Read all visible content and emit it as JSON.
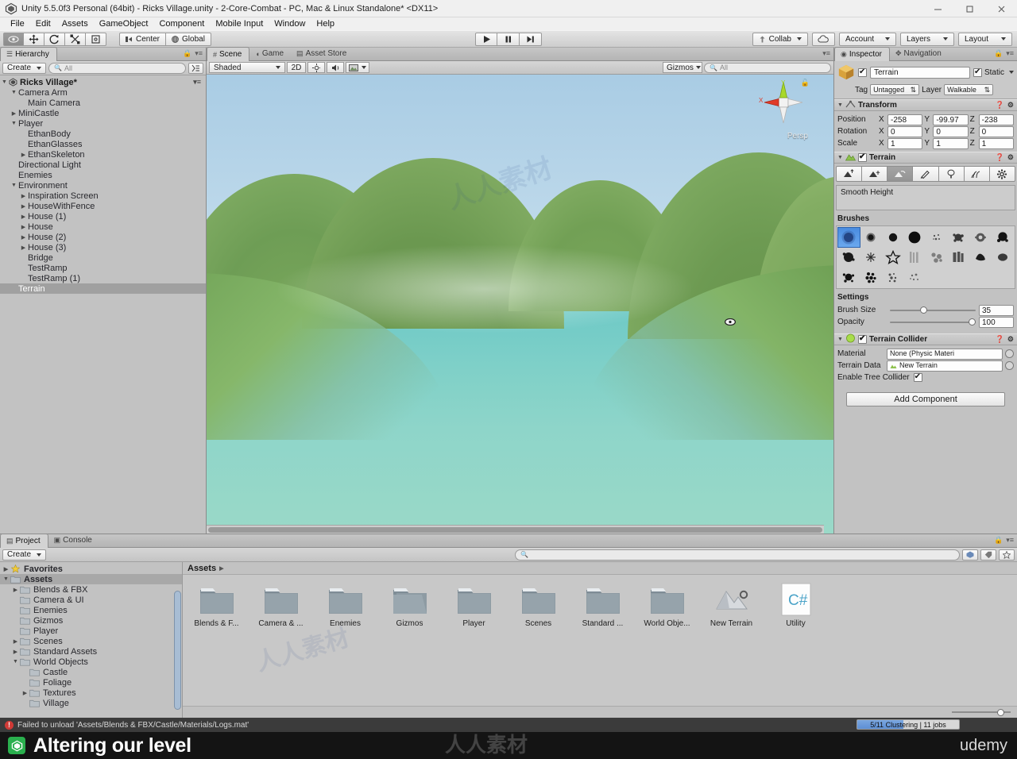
{
  "window": {
    "title": "Unity 5.5.0f3 Personal (64bit) - Ricks Village.unity - 2-Core-Combat - PC, Mac & Linux Standalone* <DX11>",
    "minimize": "–",
    "maximize": "□",
    "close": "✕"
  },
  "menubar": {
    "items": [
      "File",
      "Edit",
      "Assets",
      "GameObject",
      "Component",
      "Mobile Input",
      "Window",
      "Help"
    ]
  },
  "toolbar": {
    "tools": [
      {
        "name": "hand-tool",
        "glyph": "✥",
        "active": true
      },
      {
        "name": "move-tool",
        "glyph": "✛",
        "active": false
      },
      {
        "name": "rotate-tool",
        "glyph": "⟳",
        "active": false
      },
      {
        "name": "scale-tool",
        "glyph": "⤧",
        "active": false
      },
      {
        "name": "rect-tool",
        "glyph": "▣",
        "active": false
      }
    ],
    "pivot_label": "Center",
    "space_label": "Global",
    "play": "▶",
    "pause": "❚❚",
    "step": "▶❙",
    "collab_label": "Collab",
    "account_label": "Account",
    "layers_label": "Layers",
    "layout_label": "Layout"
  },
  "hierarchy": {
    "tab_label": "Hierarchy",
    "create_label": "Create",
    "search_placeholder": "All",
    "root": "Ricks Village*",
    "items": [
      {
        "label": "Camera Arm",
        "indent": 1,
        "arrow": "down"
      },
      {
        "label": "Main Camera",
        "indent": 2,
        "arrow": "none"
      },
      {
        "label": "MiniCastle",
        "indent": 1,
        "arrow": "right"
      },
      {
        "label": "Player",
        "indent": 1,
        "arrow": "down"
      },
      {
        "label": "EthanBody",
        "indent": 2,
        "arrow": "none"
      },
      {
        "label": "EthanGlasses",
        "indent": 2,
        "arrow": "none"
      },
      {
        "label": "EthanSkeleton",
        "indent": 2,
        "arrow": "right"
      },
      {
        "label": "Directional Light",
        "indent": 1,
        "arrow": "none"
      },
      {
        "label": "Enemies",
        "indent": 1,
        "arrow": "none"
      },
      {
        "label": "Environment",
        "indent": 1,
        "arrow": "down"
      },
      {
        "label": "Inspiration Screen",
        "indent": 2,
        "arrow": "right"
      },
      {
        "label": "HouseWithFence",
        "indent": 2,
        "arrow": "right"
      },
      {
        "label": "House (1)",
        "indent": 2,
        "arrow": "right"
      },
      {
        "label": "House",
        "indent": 2,
        "arrow": "right"
      },
      {
        "label": "House (2)",
        "indent": 2,
        "arrow": "right"
      },
      {
        "label": "House (3)",
        "indent": 2,
        "arrow": "right"
      },
      {
        "label": "Bridge",
        "indent": 2,
        "arrow": "none"
      },
      {
        "label": "TestRamp",
        "indent": 2,
        "arrow": "none"
      },
      {
        "label": "TestRamp (1)",
        "indent": 2,
        "arrow": "none"
      },
      {
        "label": "Terrain",
        "indent": 1,
        "arrow": "none",
        "selected": true
      }
    ]
  },
  "scene": {
    "tabs": [
      {
        "label": "Scene",
        "active": true
      },
      {
        "label": "Game",
        "active": false
      },
      {
        "label": "Asset Store",
        "active": false
      }
    ],
    "shading_mode": "Shaded",
    "toggle_2d": "2D",
    "gizmos_label": "Gizmos",
    "gizmos_search_placeholder": "All",
    "axis_x": "X",
    "axis_y": "Y",
    "perspective_label": "Persp"
  },
  "inspector": {
    "tabs": [
      {
        "label": "Inspector",
        "active": true
      },
      {
        "label": "Navigation",
        "active": false
      }
    ],
    "object_name": "Terrain",
    "object_enabled": true,
    "static_label": "Static",
    "static_checked": true,
    "tag_label": "Tag",
    "tag_value": "Untagged",
    "layer_label": "Layer",
    "layer_value": "Walkable",
    "transform": {
      "title": "Transform",
      "rows": [
        {
          "label": "Position",
          "x": "-258",
          "y": "-99.97",
          "z": "-238"
        },
        {
          "label": "Rotation",
          "x": "0",
          "y": "0",
          "z": "0"
        },
        {
          "label": "Scale",
          "x": "1",
          "y": "1",
          "z": "1"
        }
      ],
      "axes": [
        "X",
        "Y",
        "Z"
      ]
    },
    "terrain": {
      "title": "Terrain",
      "enabled": true,
      "tools": [
        {
          "name": "raise-lower-terrain-tool",
          "active": false
        },
        {
          "name": "paint-height-tool",
          "active": false
        },
        {
          "name": "smooth-height-tool",
          "active": true
        },
        {
          "name": "paint-texture-tool",
          "active": false
        },
        {
          "name": "place-trees-tool",
          "active": false
        },
        {
          "name": "paint-details-tool",
          "active": false
        },
        {
          "name": "terrain-settings-tool",
          "active": false
        }
      ],
      "active_tool_description": "Smooth Height",
      "brushes_label": "Brushes",
      "brush_count": 20,
      "selected_brush_index": 0,
      "settings_label": "Settings",
      "brush_size_label": "Brush Size",
      "brush_size_value": "35",
      "brush_size_pct": 35,
      "opacity_label": "Opacity",
      "opacity_value": "100",
      "opacity_pct": 100
    },
    "terrain_collider": {
      "title": "Terrain Collider",
      "enabled": true,
      "material_label": "Material",
      "material_value": "None (Physic Materi",
      "terrain_data_label": "Terrain Data",
      "terrain_data_value": "New Terrain",
      "tree_collider_label": "Enable Tree Collider",
      "tree_collider_checked": true
    },
    "add_component_label": "Add Component"
  },
  "project": {
    "tabs": [
      {
        "label": "Project",
        "active": true
      },
      {
        "label": "Console",
        "active": false
      }
    ],
    "create_label": "Create",
    "search_placeholder": "",
    "tree": [
      {
        "label": "Favorites",
        "indent": 0,
        "arrow": "right",
        "bold": true,
        "icon": "star"
      },
      {
        "label": "Assets",
        "indent": 0,
        "arrow": "down",
        "bold": true,
        "icon": "folder",
        "selected": true
      },
      {
        "label": "Blends & FBX",
        "indent": 1,
        "arrow": "right",
        "icon": "folder"
      },
      {
        "label": "Camera & UI",
        "indent": 1,
        "arrow": "none",
        "icon": "folder"
      },
      {
        "label": "Enemies",
        "indent": 1,
        "arrow": "none",
        "icon": "folder"
      },
      {
        "label": "Gizmos",
        "indent": 1,
        "arrow": "none",
        "icon": "folder"
      },
      {
        "label": "Player",
        "indent": 1,
        "arrow": "none",
        "icon": "folder"
      },
      {
        "label": "Scenes",
        "indent": 1,
        "arrow": "right",
        "icon": "folder"
      },
      {
        "label": "Standard Assets",
        "indent": 1,
        "arrow": "right",
        "icon": "folder"
      },
      {
        "label": "World Objects",
        "indent": 1,
        "arrow": "down",
        "icon": "folder"
      },
      {
        "label": "Castle",
        "indent": 2,
        "arrow": "none",
        "icon": "folder"
      },
      {
        "label": "Foliage",
        "indent": 2,
        "arrow": "none",
        "icon": "folder"
      },
      {
        "label": "Textures",
        "indent": 2,
        "arrow": "right",
        "icon": "folder"
      },
      {
        "label": "Village",
        "indent": 2,
        "arrow": "none",
        "icon": "folder"
      }
    ],
    "breadcrumb": "Assets",
    "assets": [
      {
        "label": "Blends & F...",
        "type": "folder"
      },
      {
        "label": "Camera & ...",
        "type": "folder"
      },
      {
        "label": "Enemies",
        "type": "folder"
      },
      {
        "label": "Gizmos",
        "type": "folder-open"
      },
      {
        "label": "Player",
        "type": "folder"
      },
      {
        "label": "Scenes",
        "type": "folder"
      },
      {
        "label": "Standard ...",
        "type": "folder"
      },
      {
        "label": "World Obje...",
        "type": "folder"
      },
      {
        "label": "New Terrain",
        "type": "terrain"
      },
      {
        "label": "Utility",
        "type": "csharp"
      }
    ]
  },
  "statusbar": {
    "error_message": "Failed to unload 'Assets/Blends & FBX/Castle/Materials/Logs.mat'",
    "progress_text": "5/11 Clustering | 11 jobs",
    "progress_pct": 45
  },
  "caption": {
    "badge": "U",
    "text": "Altering our level",
    "brand": "udemy"
  },
  "colors": {
    "accent_blue": "#4a8ce0",
    "selection_gray": "#a0a0a0",
    "error_red": "#d03a36",
    "sky": "#bcd8ea",
    "hill_green": "#6f9c52",
    "water_teal": "#63c4c0"
  }
}
